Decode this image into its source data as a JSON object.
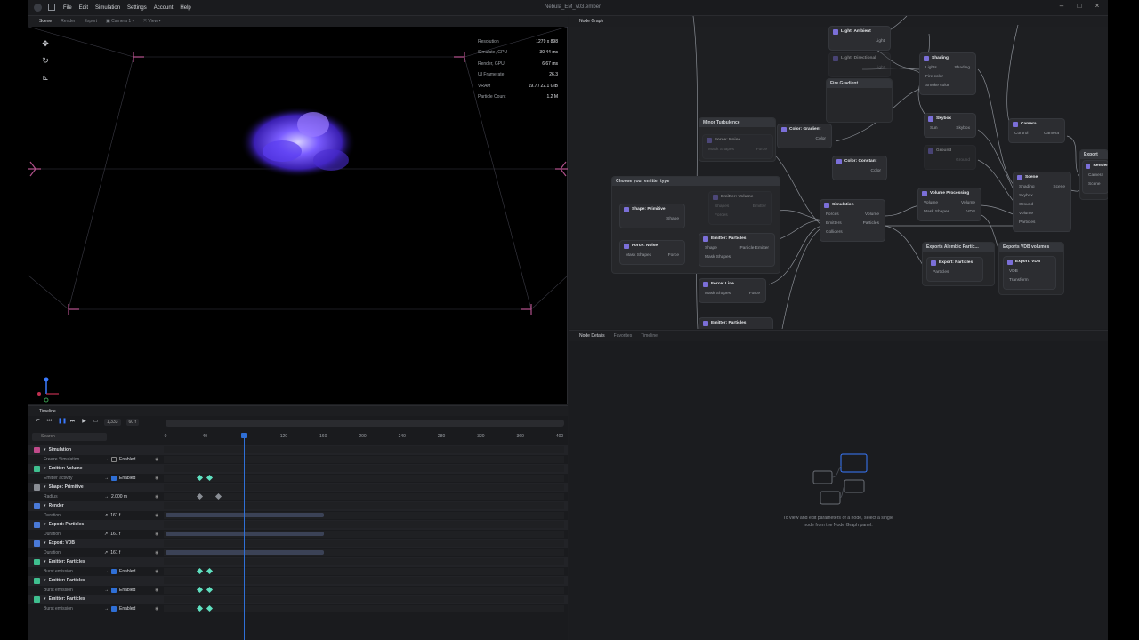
{
  "window": {
    "title": "Nebula_EM_v03.ember"
  },
  "menu": [
    "File",
    "Edit",
    "Simulation",
    "Settings",
    "Account",
    "Help"
  ],
  "viewport": {
    "tabs": [
      "Scene",
      "Render",
      "Export"
    ],
    "camera": "Camera 1",
    "view": "View",
    "stats": [
      {
        "label": "Resolution",
        "value": "1279 x 898"
      },
      {
        "label": "Simulate, GPU",
        "value": "30.44 ms"
      },
      {
        "label": "Render, GPU",
        "value": "6.67 ms"
      },
      {
        "label": "UI Framerate",
        "value": "26.3"
      },
      {
        "label": "VRAM",
        "value": "19.7 / 22.1 GiB"
      },
      {
        "label": "Particle Count",
        "value": "1.2 M"
      }
    ]
  },
  "timeline": {
    "title": "Timeline",
    "frame_field": "1,333",
    "fps_field": "60 f",
    "search_placeholder": "Search",
    "ruler": [
      "0",
      "40",
      "80",
      "120",
      "160",
      "200",
      "240",
      "280",
      "320",
      "360",
      "400"
    ],
    "rows": [
      {
        "type": "group",
        "name": "Simulation",
        "color": "#c04a8a"
      },
      {
        "type": "prop",
        "name": "Freeze Simulation",
        "value": "Enabled",
        "check": false
      },
      {
        "type": "group",
        "name": "Emitter: Volume",
        "color": "#3fbf8f"
      },
      {
        "type": "prop",
        "name": "Emitter activity",
        "value": "Enabled",
        "check": true,
        "keys": [
          0.084,
          0.108
        ]
      },
      {
        "type": "group",
        "name": "Shape: Primitive",
        "color": "#8a8e95"
      },
      {
        "type": "prop",
        "name": "Radius",
        "value": "2.000 m",
        "check": null,
        "keys": [
          0.084,
          0.132
        ],
        "gray": true
      },
      {
        "type": "group",
        "name": "Render",
        "color": "#4a7ad8"
      },
      {
        "type": "prop",
        "name": "Duration",
        "value": "161 f",
        "bar": true
      },
      {
        "type": "group",
        "name": "Export: Particles",
        "color": "#4a7ad8"
      },
      {
        "type": "prop",
        "name": "Duration",
        "value": "161 f",
        "bar": true
      },
      {
        "type": "group",
        "name": "Export: VDB",
        "color": "#4a7ad8"
      },
      {
        "type": "prop",
        "name": "Duration",
        "value": "161 f",
        "bar": true
      },
      {
        "type": "group",
        "name": "Emitter: Particles",
        "color": "#3fbf8f"
      },
      {
        "type": "prop",
        "name": "Burst emission",
        "value": "Enabled",
        "check": true,
        "keys": [
          0.084,
          0.108
        ]
      },
      {
        "type": "group",
        "name": "Emitter: Particles",
        "color": "#3fbf8f"
      },
      {
        "type": "prop",
        "name": "Burst emission",
        "value": "Enabled",
        "check": true,
        "keys": [
          0.084,
          0.108
        ]
      },
      {
        "type": "group",
        "name": "Emitter: Particles",
        "color": "#3fbf8f"
      },
      {
        "type": "prop",
        "name": "Burst emission",
        "value": "Enabled",
        "check": true,
        "keys": [
          0.084,
          0.108
        ]
      }
    ]
  },
  "node_graph": {
    "title": "Node Graph",
    "groups": [
      "Minor Turbulence",
      "Choose your emitter type",
      "Fire Gradient",
      "Exports Alembic Partic...",
      "Exports VDB volumes",
      "Export Flipbooks and I"
    ],
    "nodes": {
      "light_ambient": {
        "title": "Light: Ambient",
        "ports": [
          "Light"
        ]
      },
      "light_directional": {
        "title": "Light: Directional",
        "ports": [
          "Light"
        ]
      },
      "shading": {
        "title": "Shading",
        "ports": [
          "Lights",
          "Fire color",
          "Smoke color"
        ],
        "out": "Shading"
      },
      "skybox": {
        "title": "Skybox",
        "ports": [
          "Sun"
        ],
        "out": "Skybox"
      },
      "ground": {
        "title": "Ground",
        "out": "Ground"
      },
      "camera": {
        "title": "Camera",
        "ports": [
          "Control"
        ],
        "out": "Camera"
      },
      "render": {
        "title": "Render",
        "ports": [
          "Camera",
          "Scene"
        ]
      },
      "scene": {
        "title": "Scene",
        "ports": [
          "Shading",
          "Skybox",
          "Ground",
          "Volume",
          "Particles"
        ],
        "out": "Scene"
      },
      "force_noise_top": {
        "title": "Force: Noise",
        "ports": [
          "Mask Shapes"
        ],
        "out": "Force"
      },
      "color_gradient": {
        "title": "Color: Gradient",
        "out": "Color"
      },
      "color_constant": {
        "title": "Color: Constant",
        "out": "Color"
      },
      "shape_primitive": {
        "title": "Shape: Primitive",
        "out": "Shape"
      },
      "emitter_volume": {
        "title": "Emitter: Volume",
        "ports": [
          "Shapes",
          "Forces"
        ],
        "out": "Emitter"
      },
      "force_noise": {
        "title": "Force: Noise",
        "ports": [
          "Mask Shapes"
        ],
        "out": "Force"
      },
      "emitter_particles": {
        "title": "Emitter: Particles",
        "ports": [
          "Shape",
          "Mask Shapes"
        ],
        "out": "Particle Emitter"
      },
      "force_line": {
        "title": "Force: Line",
        "ports": [
          "Mask Shapes"
        ],
        "out": "Force"
      },
      "emitter_particles2": {
        "title": "Emitter: Particles"
      },
      "simulation": {
        "title": "Simulation",
        "ports": [
          "Forces",
          "Emitters",
          "Colliders"
        ],
        "outs": [
          "Volume",
          "Particles"
        ]
      },
      "volume_processing": {
        "title": "Volume Processing",
        "ports": [
          "Volume",
          "Mask Shapes"
        ],
        "outs": [
          "Volume",
          "VDB"
        ]
      },
      "export_particles": {
        "title": "Export: Particles",
        "ports": [
          "Particles"
        ]
      },
      "export_vdb": {
        "title": "Export: VDB",
        "ports": [
          "VDB",
          "Transform"
        ]
      }
    }
  },
  "node_details": {
    "tabs": [
      "Node Details",
      "Favorites",
      "Timeline"
    ],
    "hint_line1": "To view and edit parameters of a node, select a single",
    "hint_line2": "node from the Node Graph panel."
  },
  "colors": {
    "accent": "#2f6fd6",
    "keyframe": "#5fe0c0",
    "nebula": "#6a4cff"
  }
}
